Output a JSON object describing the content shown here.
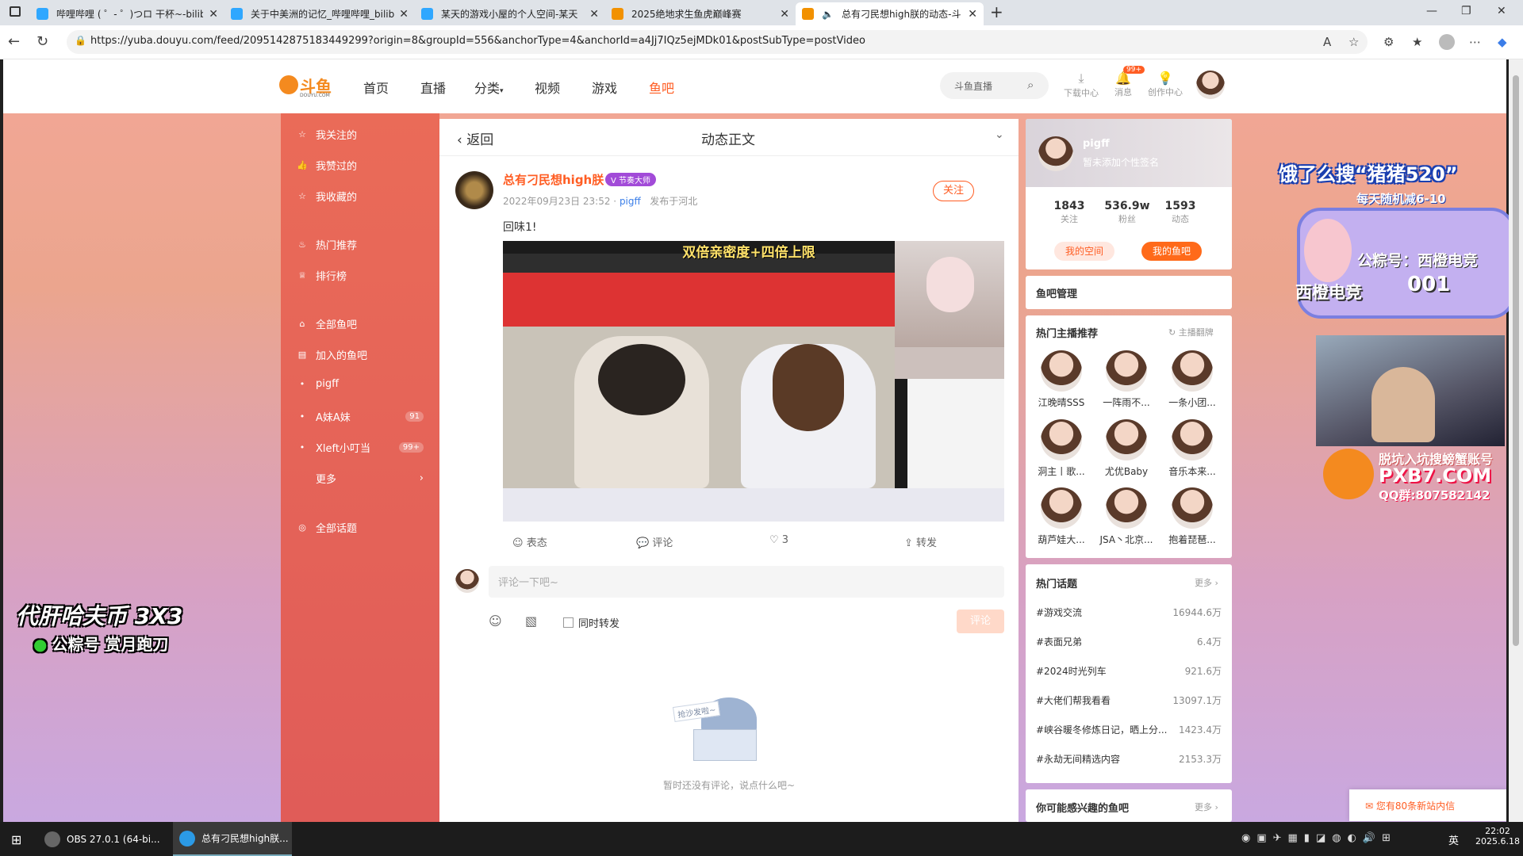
{
  "tabs": [
    {
      "title": "哔哩哔哩 ( ゜- ゜)つロ 干杯~-bilib",
      "active": false
    },
    {
      "title": "关于中美洲的记忆_哔哩哔哩_bilib",
      "active": false
    },
    {
      "title": "某天的游戏小屋的个人空间-某天",
      "active": false
    },
    {
      "title": "2025绝地求生鱼虎巅峰赛",
      "active": false
    },
    {
      "title": "总有刁民想high朕的动态-斗",
      "active": true
    }
  ],
  "url": "https://yuba.douyu.com/feed/2095142875183449299?origin=8&groupId=556&anchorType=4&anchorId=a4Jj7IQz5ejMDk01&postSubType=postVideo",
  "nav": {
    "logo": "斗鱼",
    "logo_sub": "DOUYU.COM",
    "items": [
      "首页",
      "直播",
      "分类",
      "视频",
      "游戏",
      "鱼吧"
    ],
    "search_placeholder": "斗鱼直播",
    "download": "下载中心",
    "messages": "消息",
    "messages_badge": "99+",
    "creator": "创作中心"
  },
  "sidebar": {
    "items": [
      {
        "label": "我关注的",
        "icon": "star-icon"
      },
      {
        "label": "我赞过的",
        "icon": "thumb-icon"
      },
      {
        "label": "我收藏的",
        "icon": "star-icon"
      },
      {
        "label": "热门推荐",
        "icon": "fire-icon"
      },
      {
        "label": "排行榜",
        "icon": "trophy-icon"
      },
      {
        "label": "全部鱼吧",
        "icon": "home-icon"
      },
      {
        "label": "加入的鱼吧",
        "icon": "doc-icon"
      },
      {
        "label": "pigff",
        "icon": "dot"
      },
      {
        "label": "A妹A妹",
        "icon": "dot",
        "count": "91"
      },
      {
        "label": "Xleft小叮当",
        "icon": "dot",
        "count": "99+"
      },
      {
        "label": "更多",
        "icon": "none"
      },
      {
        "label": "全部话题",
        "icon": "topic-icon"
      }
    ]
  },
  "post": {
    "back": "返回",
    "header": "动态正文",
    "author": "总有刁民想high朕",
    "badge": "节奏大师",
    "level": "V",
    "date": "2022年09月23日 23:52 ·",
    "group": "pigff",
    "location": "发布于河北",
    "follow": "关注",
    "text": "回味1!",
    "video_caption": "双倍亲密度+四倍上限",
    "actions": {
      "share": "表态",
      "comment": "评论",
      "like": "3",
      "forward": "转发"
    },
    "comment_placeholder": "评论一下吧~",
    "repost": "同时转发",
    "submit": "评论",
    "empty_tag": "抢沙发啦~",
    "empty_text": "暂时还没有评论，说点什么吧~"
  },
  "profile": {
    "name": "pigff",
    "signature": "暂未添加个性签名",
    "stats": [
      {
        "value": "1843",
        "label": "关注"
      },
      {
        "value": "536.9w",
        "label": "粉丝"
      },
      {
        "value": "1593",
        "label": "动态"
      }
    ],
    "btn_space": "我的空间",
    "btn_group": "我的鱼吧"
  },
  "manage": "鱼吧管理",
  "hot_anchors": {
    "title": "热门主播推荐",
    "refresh": "主播翻牌",
    "items": [
      "江晚晴SSS",
      "一阵雨不...",
      "一条小团...",
      "洞主丨歌...",
      "尤优Baby",
      "音乐本来...",
      "葫芦娃大...",
      "JSA丶北京...",
      "抱着琵琶..."
    ]
  },
  "hot_topics": {
    "title": "热门话题",
    "more": "更多",
    "items": [
      {
        "name": "#游戏交流",
        "count": "16944.6万"
      },
      {
        "name": "#表面兄弟",
        "count": "6.4万"
      },
      {
        "name": "#2024时光列车",
        "count": "921.6万"
      },
      {
        "name": "#大佬们帮我看看",
        "count": "13097.1万"
      },
      {
        "name": "#峡谷暖冬修炼日记，晒上分...",
        "count": "1423.4万"
      },
      {
        "name": "#永劫无间精选内容",
        "count": "2153.3万"
      }
    ]
  },
  "maybe_like": {
    "title": "你可能感兴趣的鱼吧",
    "more": "更多"
  },
  "inbox": "您有80条新站内信",
  "overlay": {
    "left_big": "代肝哈夫币 3X3",
    "left_small": "公粽号 赏月跑刀",
    "right_top": "饿了么搜“猪猪520”",
    "right_sub": "每天随机减6-10",
    "right_gzh": "公粽号：西橙电竞",
    "right_name": "西橙电竞",
    "right_num": "001",
    "bottom_a": "脱坑入坑搜螃蟹账号",
    "bottom_b": "PXB7.COM",
    "bottom_c": "QQ群:807582142"
  },
  "taskbar": {
    "apps": [
      "OBS 27.0.1 (64-bi...",
      "总有刁民想high朕..."
    ],
    "time": "22:02",
    "date": "2025.6.18",
    "ime": "英"
  }
}
